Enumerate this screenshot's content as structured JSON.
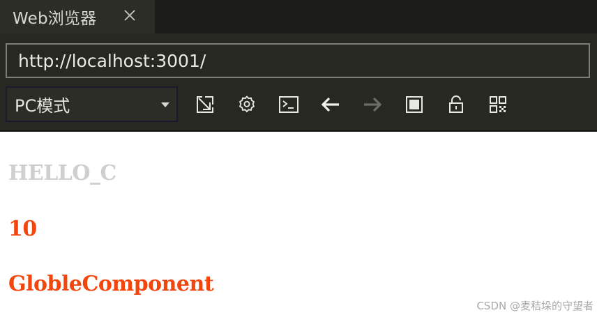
{
  "tab": {
    "title": "Web浏览器",
    "close_icon": "close-icon"
  },
  "address_bar": {
    "url": "http://localhost:3001/"
  },
  "mode_select": {
    "selected": "PC模式"
  },
  "toolbar": {
    "icons": [
      "popout-icon",
      "gear-icon",
      "terminal-icon",
      "arrow-left-icon",
      "arrow-right-icon",
      "stop-icon",
      "unlock-icon",
      "qr-code-icon"
    ]
  },
  "page": {
    "line1": "HELLO_C",
    "line2": "10",
    "line3": "GlobleComponent"
  },
  "watermark": "CSDN @麦秸垛的守望者",
  "colors": {
    "tab_bar_bg": "#1b1c18",
    "active_tab_bg": "#2c2d27",
    "toolbar_bg": "#272822",
    "grey_text": "#cfcfcf",
    "accent_orange": "#f2460d"
  }
}
